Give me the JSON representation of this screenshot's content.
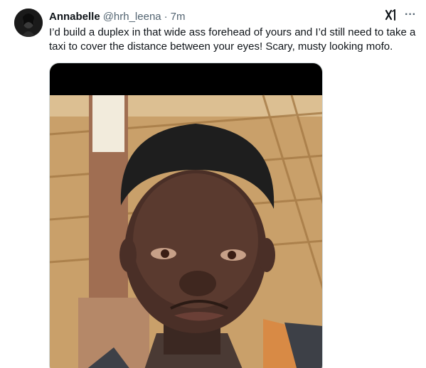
{
  "tweet": {
    "author": {
      "display_name": "Annabelle",
      "handle": "@hrh_leena",
      "separator": "·",
      "time": "7m",
      "avatar_icon": "profile-avatar"
    },
    "header_icons": {
      "grok": "grok-icon",
      "more": "more-icon",
      "more_glyph": "···"
    },
    "text": "I’d build a duplex in that wide ass forehead of yours and I’d still need to take a taxi to cover the distance between your eyes! Scary, musty looking mofo.",
    "media": {
      "type": "photo"
    }
  },
  "colors": {
    "text_primary": "#0f1419",
    "text_secondary": "#536471",
    "border": "#cfd9de",
    "background": "#ffffff"
  }
}
